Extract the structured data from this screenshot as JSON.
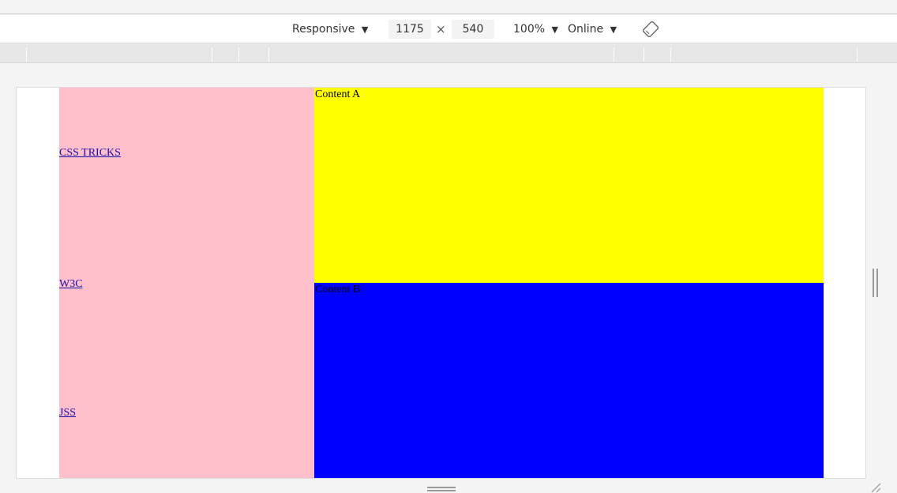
{
  "toolbar": {
    "device_label": "Responsive",
    "width_value": "1175",
    "times": "×",
    "height_value": "540",
    "zoom_label": "100%",
    "network_label": "Online",
    "dropdown_glyph": "▼"
  },
  "page": {
    "nav_links": [
      "CSS TRICKS",
      "W3C",
      "JSS"
    ],
    "content_a": "Content A",
    "content_b": "Content B"
  },
  "colors": {
    "sidebar_bg": "#ffc0cb",
    "content_a_bg": "#ffff00",
    "content_b_bg": "#0000ff",
    "link": "#1a0dab"
  },
  "icons": {
    "rotate": "rotate-icon",
    "dropdown": "dropdown-arrow-icon"
  }
}
